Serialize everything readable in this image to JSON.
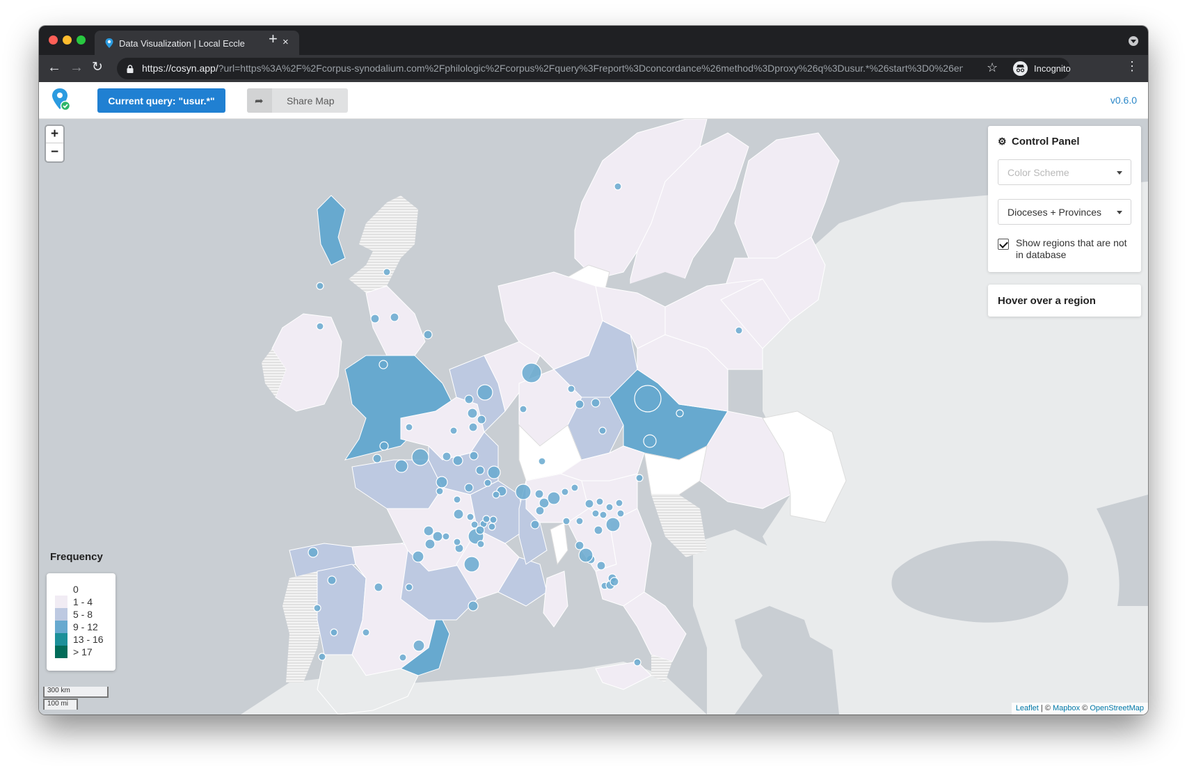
{
  "browser": {
    "tab_title": "Data Visualization | Local Eccle",
    "tab_close": "×",
    "new_tab": "+",
    "url_host": "https://cosyn.app/",
    "url_rest": "?url=https%3A%2F%2Fcorpus-synodalium.com%2Fphilologic%2Fcorpus%2Fquery%3Freport%3Dconcordance%26method%3Dproxy%26q%3Dusur.*%26start%3D0%26en…",
    "incognito_label": "Incognito",
    "icons": [
      "back-arrow-icon",
      "forward-arrow-icon",
      "reload-icon",
      "lock-icon",
      "star-icon",
      "incognito-icon",
      "kebab-menu-icon"
    ]
  },
  "header": {
    "query_button": "Current query: \"usur.*\"",
    "share_button": "Share Map",
    "version": "v0.6.0"
  },
  "map": {
    "zoom_in": "+",
    "zoom_out": "−",
    "control_panel": {
      "title": "Control Panel",
      "color_scheme_placeholder": "Color Scheme",
      "region_select_value": "Dioceses + Provinces",
      "show_regions_label": "Show regions that are not in database",
      "show_regions_checked": true
    },
    "hover_panel": "Hover over a region",
    "legend": {
      "title": "Frequency",
      "items": [
        {
          "label": "0",
          "color": "#ffffff"
        },
        {
          "label": "1 - 4",
          "color": "#f1ecf4"
        },
        {
          "label": "5 - 8",
          "color": "#bdc9e1"
        },
        {
          "label": "9 - 12",
          "color": "#67a9cf"
        },
        {
          "label": "13 - 16",
          "color": "#1c9099"
        },
        {
          "label": "> 17",
          "color": "#016c59"
        }
      ]
    },
    "scale": {
      "km": "300 km",
      "mi": "100 mi"
    },
    "attribution": {
      "leaflet": "Leaflet",
      "sep1": " | © ",
      "mapbox": "Mapbox",
      "sep2": " © ",
      "osm": "OpenStreetMap"
    }
  },
  "colors": {
    "sea": "#c9ced3",
    "land_outside": "#e9ebec",
    "accent": "#2080d2",
    "marker": "#67a9cf"
  }
}
